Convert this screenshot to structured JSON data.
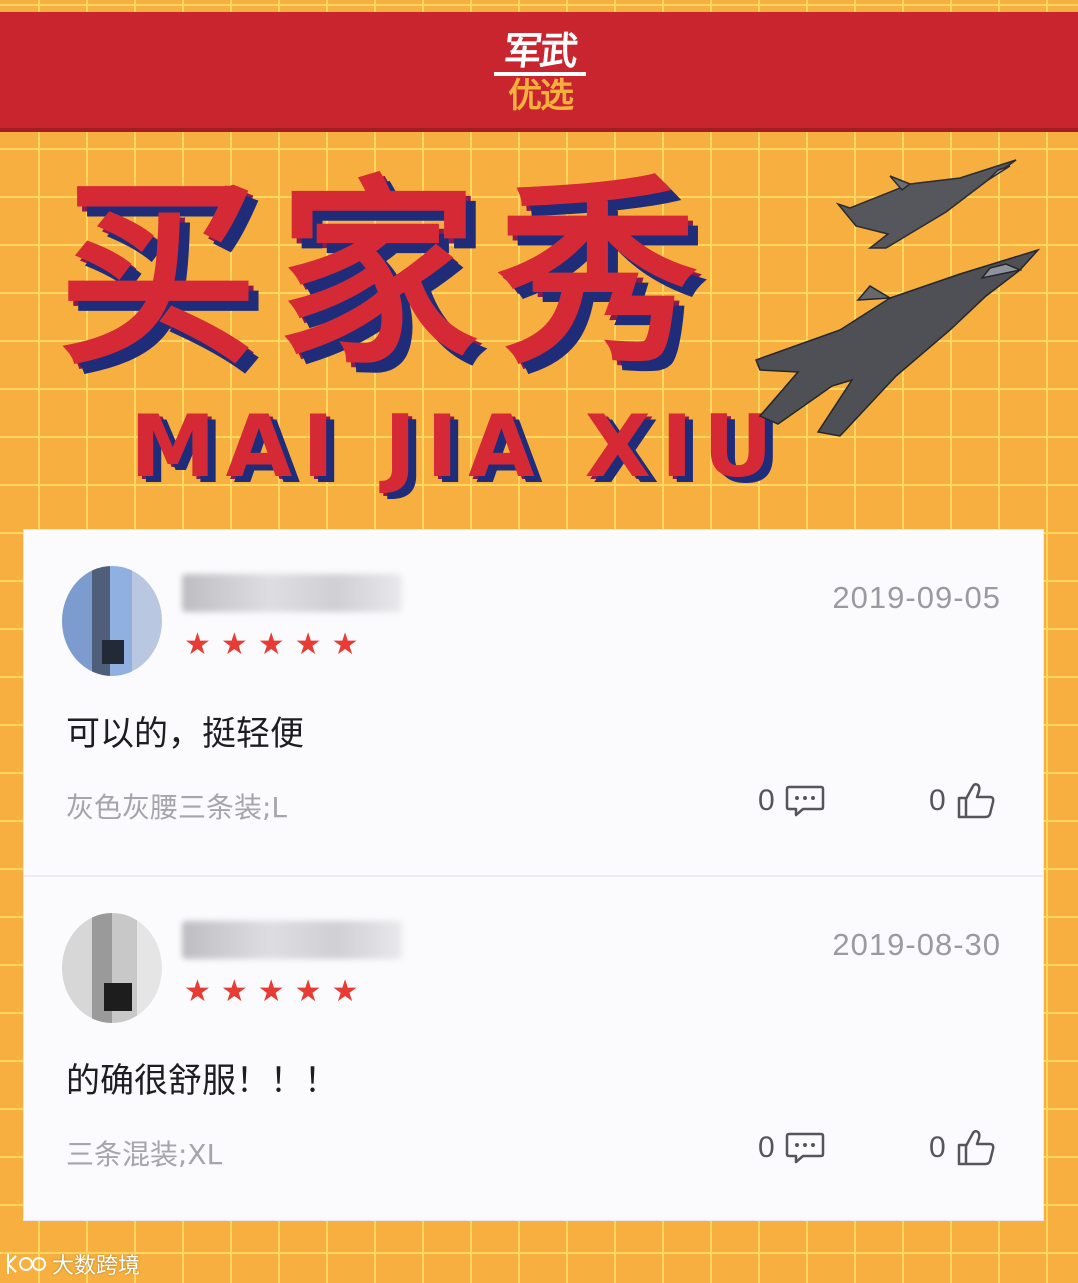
{
  "logo": {
    "top": "军武",
    "bottom": "优选"
  },
  "banner": {
    "title_cn": "买家秀",
    "title_en": "MAI JIA XIU"
  },
  "reviews": [
    {
      "date": "2019-09-05",
      "rating": 5,
      "stars": "★★★★★",
      "comment": "可以的，挺轻便",
      "variant": "灰色灰腰三条装;L",
      "reply_count": "0",
      "like_count": "0"
    },
    {
      "date": "2019-08-30",
      "rating": 5,
      "stars": "★★★★★",
      "comment": "的确很舒服！！！",
      "variant": "三条混装;XL",
      "reply_count": "0",
      "like_count": "0"
    }
  ],
  "watermark": {
    "text": "大数跨境"
  },
  "colors": {
    "background": "#f7b03f",
    "grid": "#ffd760",
    "header": "#c9252f",
    "title_red": "#d52a36",
    "title_shadow": "#1f2c7a",
    "star": "#e63c35"
  }
}
